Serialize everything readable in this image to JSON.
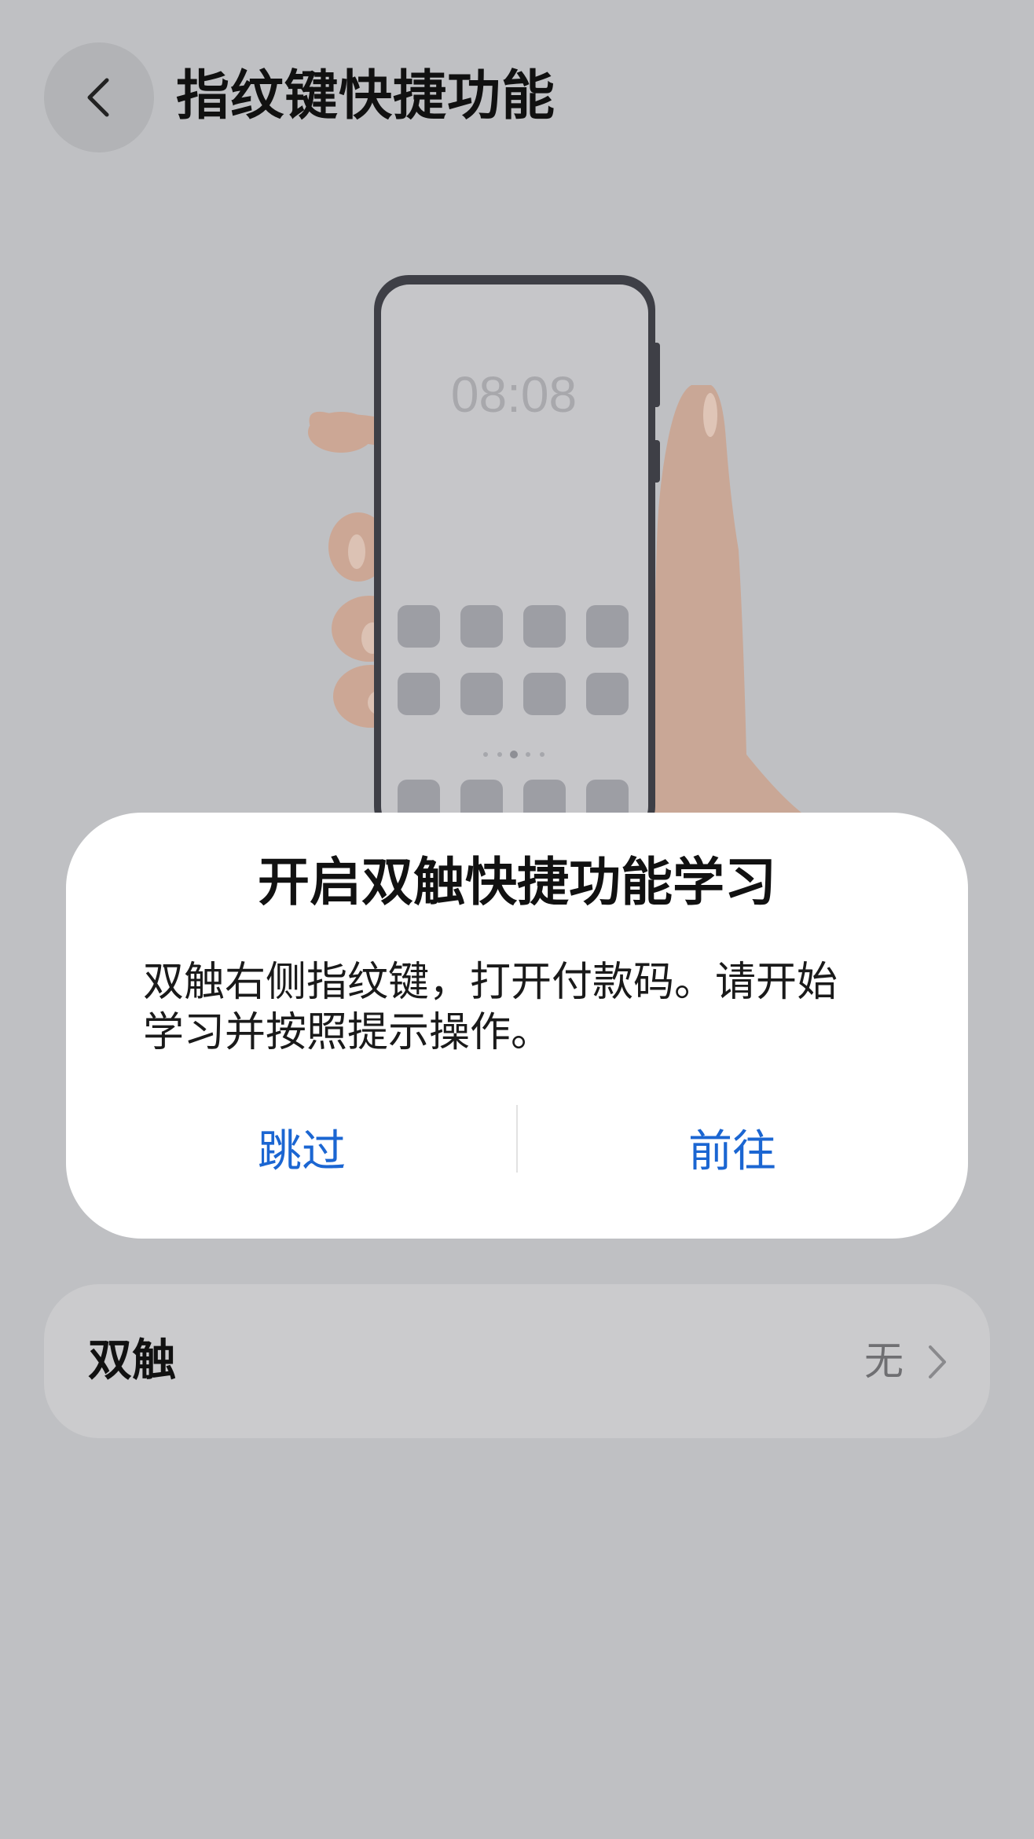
{
  "header": {
    "title": "指纹键快捷功能"
  },
  "illustration": {
    "clock": "08:08"
  },
  "dialog": {
    "title": "开启双触快捷功能学习",
    "message_line1": "双触右侧指纹键，打开付款码。请开始",
    "message_line2": "学习并按照提示操作。",
    "skip_label": "跳过",
    "goto_label": "前往"
  },
  "settings": {
    "double_tap_label": "双触",
    "double_tap_value": "无"
  },
  "colors": {
    "background": "#bfc0c3",
    "dialog_bg": "#ffffff",
    "accent_blue": "#1b66d2",
    "row_bg": "#cbcbcd"
  }
}
